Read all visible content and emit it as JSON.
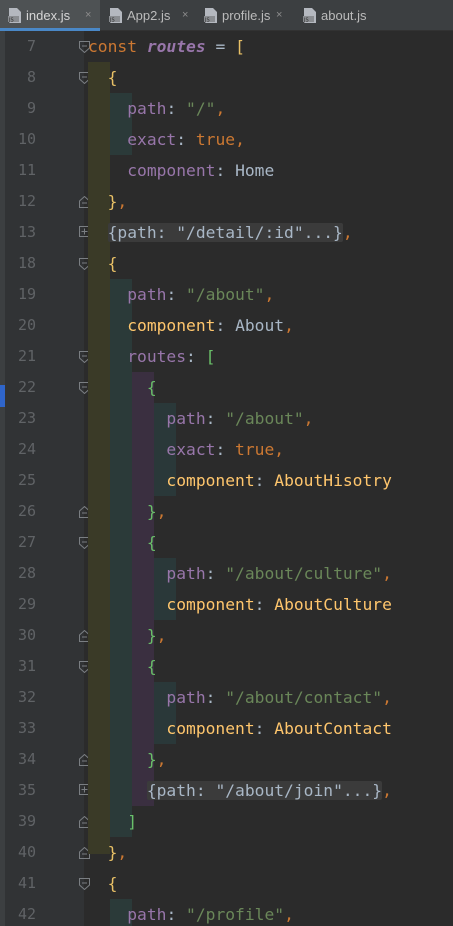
{
  "tabs": [
    {
      "label": "index.js",
      "icon": "js-file-icon",
      "active": true
    },
    {
      "label": "App2.js",
      "icon": "js-file-icon",
      "active": false
    },
    {
      "label": "profile.js",
      "icon": "js-file-icon",
      "active": false
    },
    {
      "label": "about.js",
      "icon": "js-file-icon",
      "active": false
    }
  ],
  "tab_close_glyph": "×",
  "line_numbers": [
    "7",
    "8",
    "9",
    "10",
    "11",
    "12",
    "13",
    "18",
    "19",
    "20",
    "21",
    "22",
    "23",
    "24",
    "25",
    "26",
    "27",
    "28",
    "29",
    "30",
    "31",
    "32",
    "33",
    "34",
    "35",
    "39",
    "40",
    "41",
    "42"
  ],
  "code": {
    "l7": {
      "kw": "const",
      "var": "routes",
      "eq": " = ",
      "br": "["
    },
    "l8": {
      "br": "{"
    },
    "l9": {
      "prop": "path",
      "colon": ": ",
      "str": "\"/\"",
      "comma": ","
    },
    "l10": {
      "prop": "exact",
      "colon": ": ",
      "val": "true",
      "comma": ","
    },
    "l11": {
      "prop": "component",
      "colon": ": ",
      "val": "Home"
    },
    "l12": {
      "br": "}",
      "comma": ","
    },
    "l13": {
      "folded": "{path: \"/detail/:id\"...}",
      "comma": ","
    },
    "l18": {
      "br": "{"
    },
    "l19": {
      "prop": "path",
      "colon": ": ",
      "str": "\"/about\"",
      "comma": ","
    },
    "l20": {
      "prop": "component",
      "colon": ": ",
      "val": "About",
      "comma": ","
    },
    "l21": {
      "prop": "routes",
      "colon": ": ",
      "br": "["
    },
    "l22": {
      "br": "{"
    },
    "l23": {
      "prop": "path",
      "colon": ": ",
      "str": "\"/about\"",
      "comma": ","
    },
    "l24": {
      "prop": "exact",
      "colon": ": ",
      "val": "true",
      "comma": ","
    },
    "l25": {
      "prop": "component",
      "colon": ": ",
      "val": "AboutHisotry"
    },
    "l26": {
      "br": "}",
      "comma": ","
    },
    "l27": {
      "br": "{"
    },
    "l28": {
      "prop": "path",
      "colon": ": ",
      "str": "\"/about/culture\"",
      "comma": ","
    },
    "l29": {
      "prop": "component",
      "colon": ": ",
      "val": "AboutCulture"
    },
    "l30": {
      "br": "}",
      "comma": ","
    },
    "l31": {
      "br": "{"
    },
    "l32": {
      "prop": "path",
      "colon": ": ",
      "str": "\"/about/contact\"",
      "comma": ","
    },
    "l33": {
      "prop": "component",
      "colon": ": ",
      "val": "AboutContact"
    },
    "l34": {
      "br": "}",
      "comma": ","
    },
    "l35": {
      "folded": "{path: \"/about/join\"...}",
      "comma": ","
    },
    "l39": {
      "br": "]"
    },
    "l40": {
      "br": "}",
      "comma": ","
    },
    "l41": {
      "br": "{"
    },
    "l42": {
      "prop": "path",
      "colon": ": ",
      "str": "\"/profile\"",
      "comma": ","
    }
  },
  "colors": {
    "editor_bg": "#2b2b2b",
    "gutter_bg": "#313335",
    "keyword": "#cc7832",
    "property": "#9876aa",
    "string": "#6a8759",
    "function_name": "#ffc66d",
    "bracket_level1": "#e8c066",
    "bracket_level3": "#6abf69",
    "active_tab_underline": "#4a88c7"
  }
}
